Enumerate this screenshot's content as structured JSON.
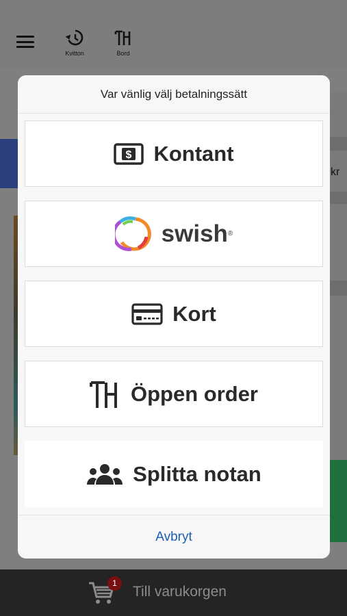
{
  "topbar": {
    "menu_icon": "menu-icon",
    "kvitton_label": "Kvitton",
    "bord_label": "Bord"
  },
  "background": {
    "price_fragment": "kr"
  },
  "modal": {
    "title": "Var vänlig välj betalningssätt",
    "options": [
      {
        "label": "Kontant",
        "icon": "cash-icon"
      },
      {
        "label": "swish",
        "icon": "swish-logo"
      },
      {
        "label": "Kort",
        "icon": "credit-card-icon"
      },
      {
        "label": "Öppen order",
        "icon": "table-icon"
      },
      {
        "label": "Splitta notan",
        "icon": "group-icon"
      }
    ],
    "cancel_label": "Avbryt"
  },
  "bottom_bar": {
    "cart_badge": "1",
    "cart_label": "Till varukorgen"
  }
}
